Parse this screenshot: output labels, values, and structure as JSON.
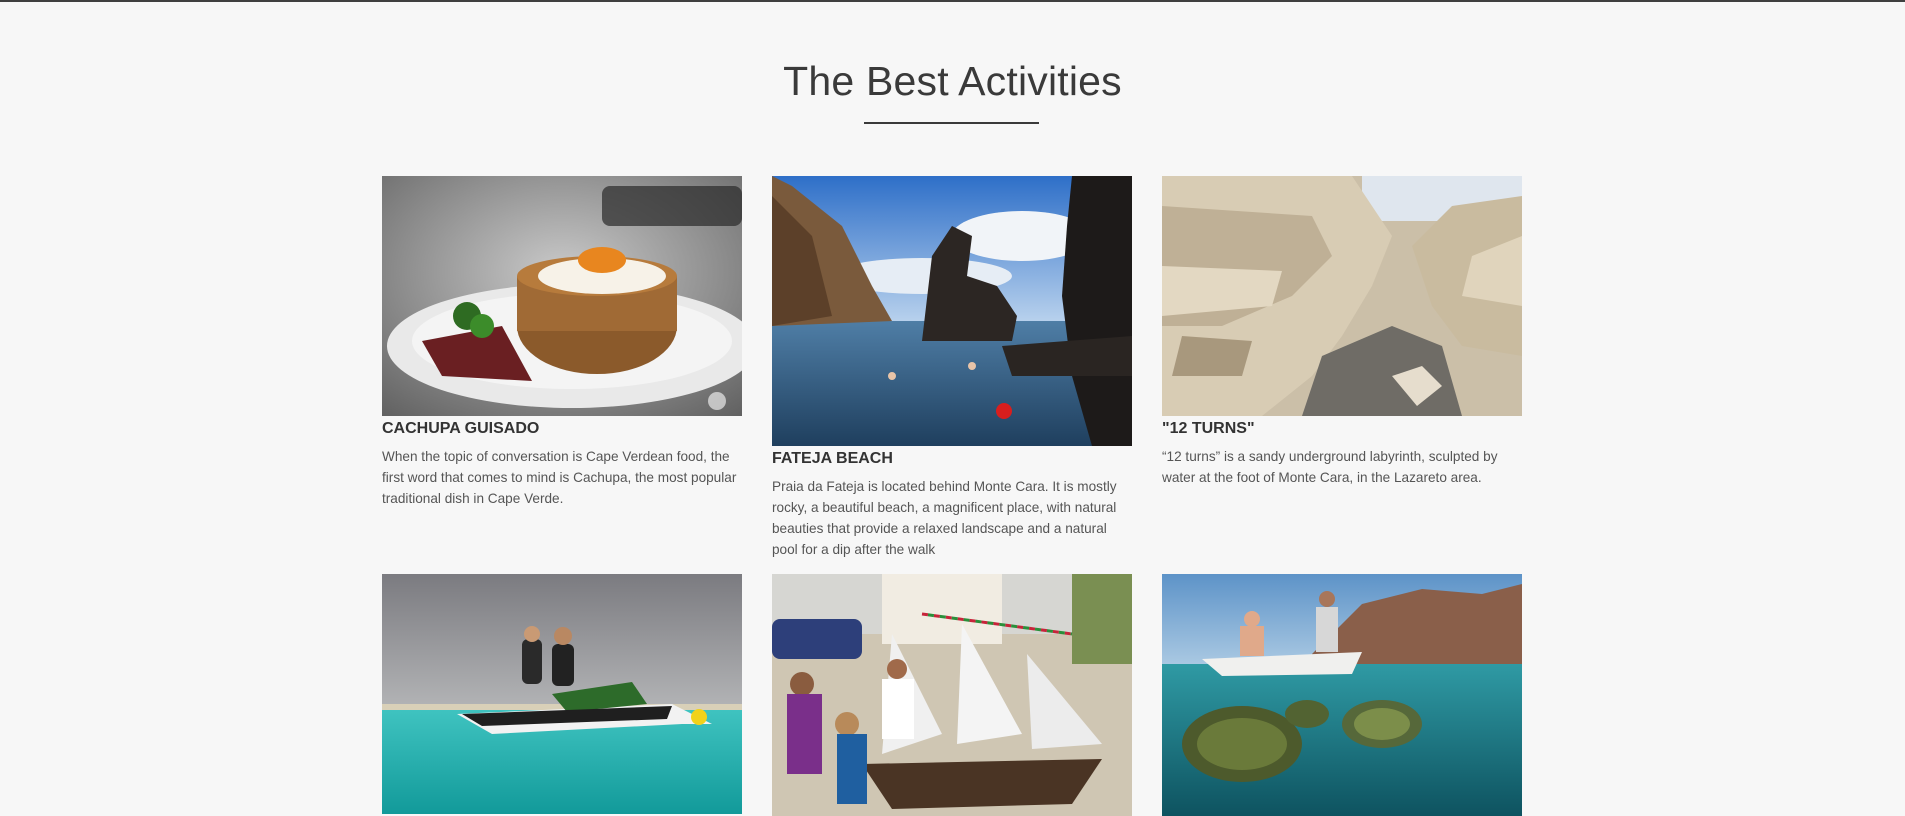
{
  "section": {
    "title": "The Best Activities"
  },
  "activities": [
    {
      "name": "CACHUPA GUISADO",
      "description": "When the topic of conversation is Cape Verdean food, the first word that comes to mind is Cachupa, the most popular traditional dish in Cape Verde."
    },
    {
      "name": "FATEJA BEACH",
      "description": "Praia da Fateja is located behind Monte Cara. It is mostly rocky, a beautiful beach, a magnificent place, with natural beauties that provide a relaxed landscape and a natural pool for a dip after the walk"
    },
    {
      "name": "\"12 TURNS\"",
      "description": "“12 turns” is a sandy underground labyrinth, sculpted by water at the foot of Monte Cara, in the Lazareto area."
    },
    {
      "name": "",
      "description": ""
    },
    {
      "name": "",
      "description": ""
    },
    {
      "name": "",
      "description": ""
    }
  ]
}
